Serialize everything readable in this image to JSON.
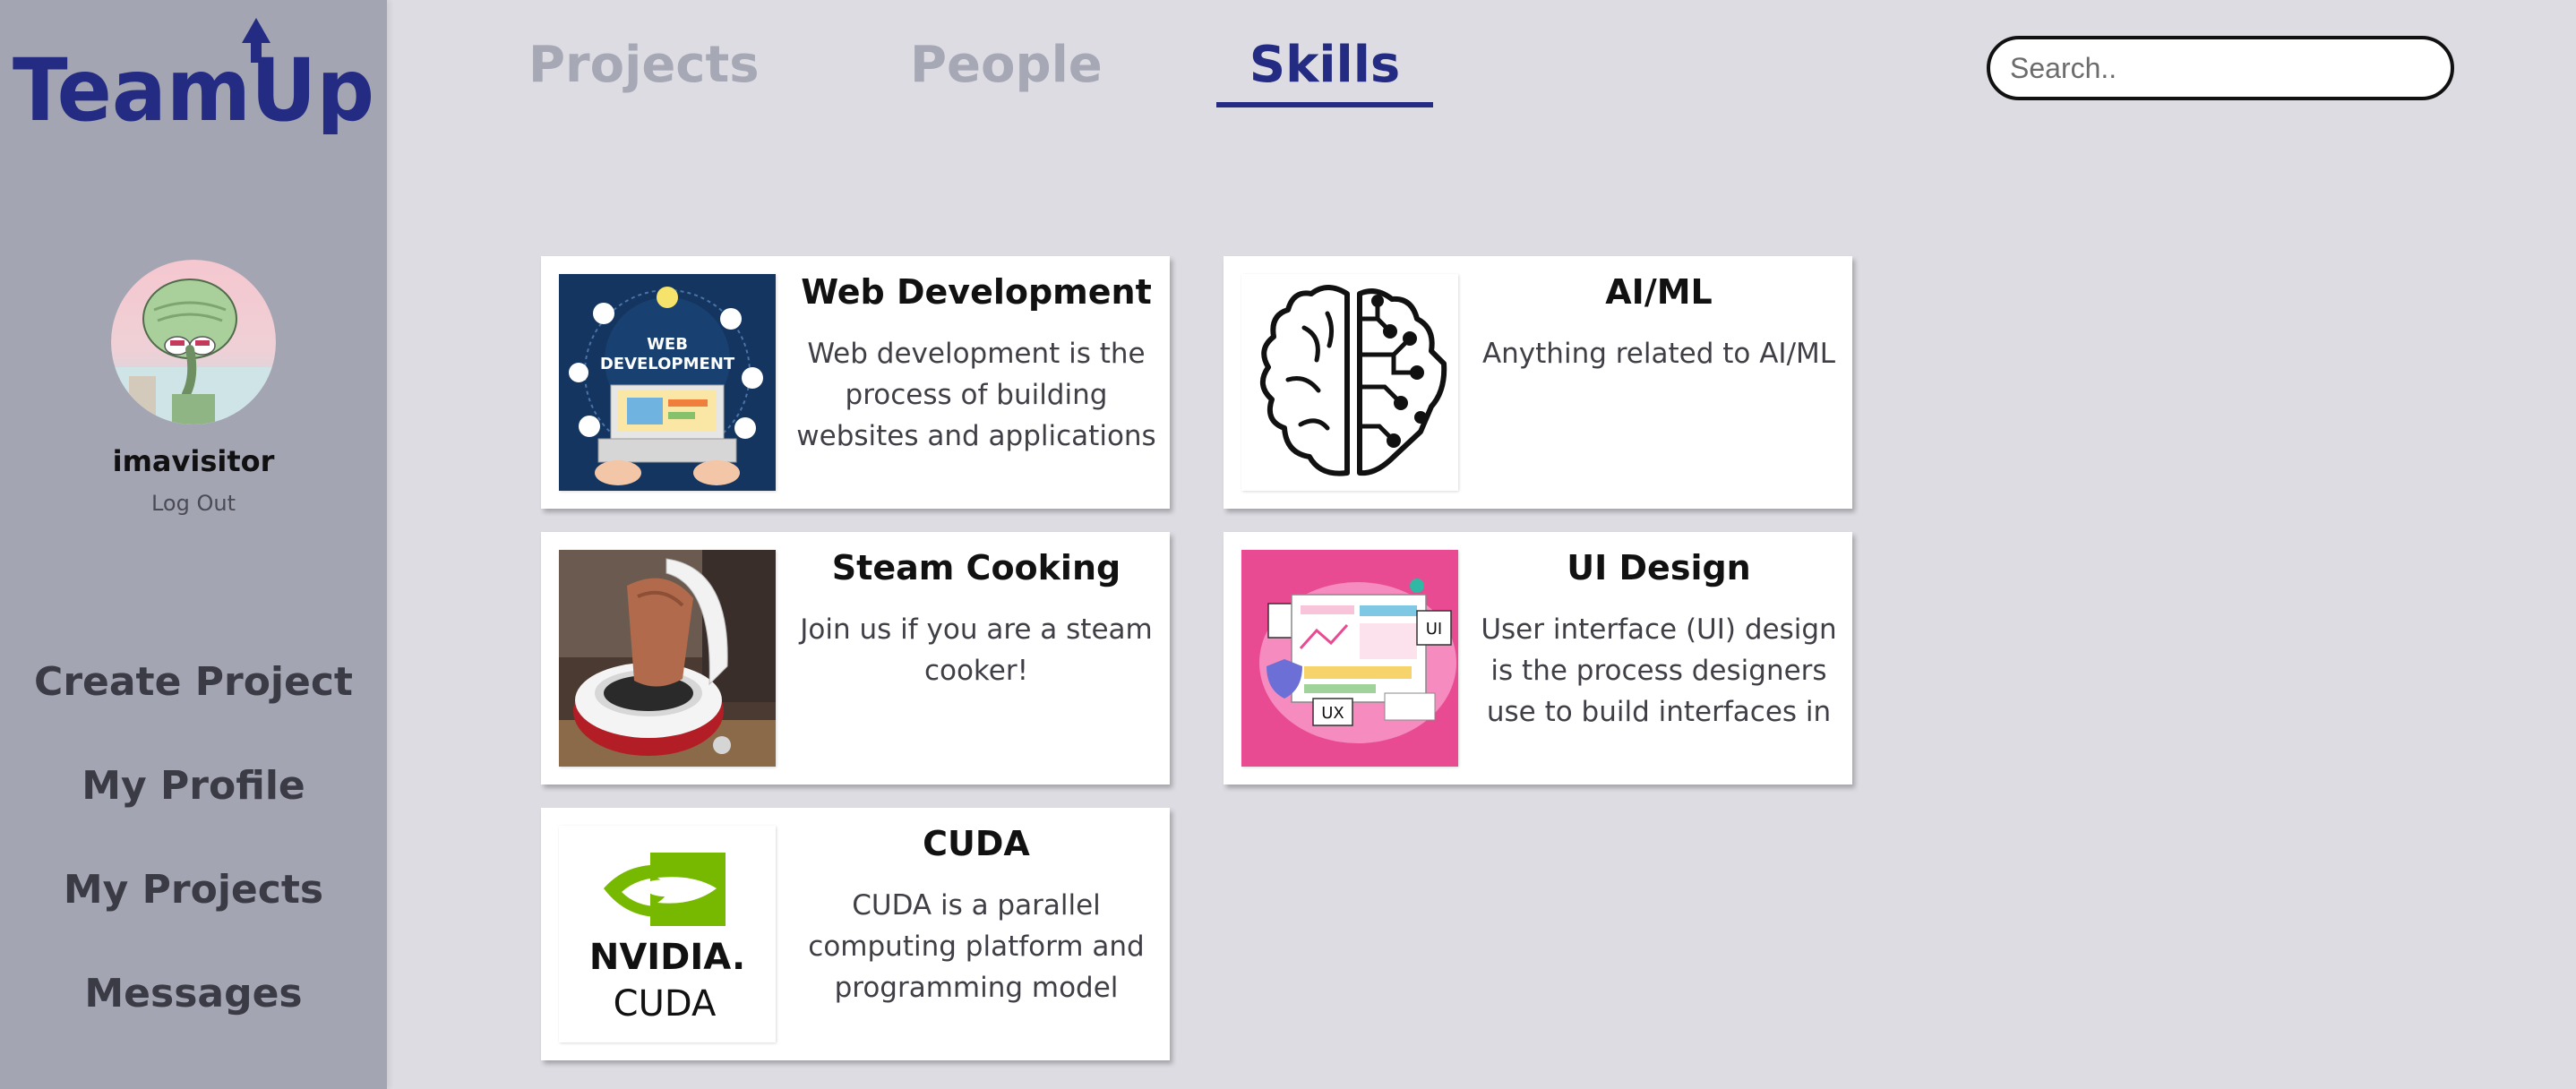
{
  "app": {
    "logo_text": "TeamUp",
    "brand_color": "#242b82"
  },
  "sidebar": {
    "username": "imavisitor",
    "logout_label": "Log Out",
    "nav": [
      {
        "label": "Create Project"
      },
      {
        "label": "My Profile"
      },
      {
        "label": "My Projects"
      },
      {
        "label": "Messages"
      }
    ]
  },
  "tabs": [
    {
      "label": "Projects",
      "active": false
    },
    {
      "label": "People",
      "active": false
    },
    {
      "label": "Skills",
      "active": true
    }
  ],
  "search": {
    "placeholder": "Search.."
  },
  "skills": [
    {
      "title": "Web Development",
      "description": "Web development is the process of building websites and applications",
      "image": "web-development-illustration",
      "image_text": [
        "WEB",
        "DEVELOPMENT"
      ]
    },
    {
      "title": "AI/ML",
      "description": "Anything related to AI/ML",
      "image": "brain-circuit-icon"
    },
    {
      "title": "Steam Cooking",
      "description": "Join us if you are a steam cooker!",
      "image": "steam-cooker-photo"
    },
    {
      "title": "UI Design",
      "description": "User interface (UI) design is the process designers use to build interfaces in",
      "image": "ui-ux-design-illustration",
      "image_text": [
        "UI",
        "UX"
      ]
    },
    {
      "title": "CUDA",
      "description": "CUDA is a parallel computing platform and programming model",
      "image": "nvidia-cuda-logo",
      "image_text": [
        "NVIDIA.",
        "CUDA"
      ]
    }
  ]
}
